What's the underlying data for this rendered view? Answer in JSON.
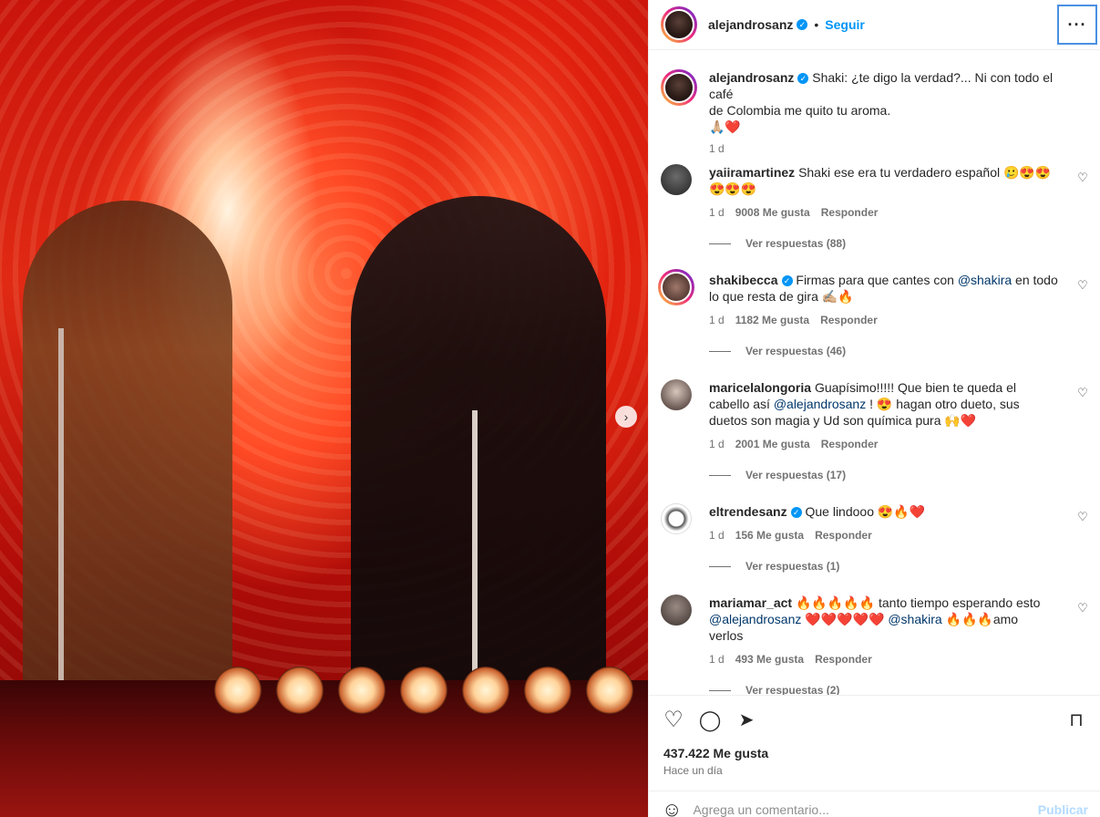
{
  "post": {
    "author": "alejandrosanz",
    "follow_label": "Seguir",
    "more_label": "···",
    "caption": {
      "username": "alejandrosanz",
      "text_line1": "Shaki: ¿te digo la verdad?... Ni con todo el café",
      "text_line2": "de Colombia me quito tu aroma.",
      "emojis": "🙏🏼❤️",
      "time": "1 d"
    }
  },
  "comments": [
    {
      "username": "yaiiramartinez",
      "line1": "Shaki ese era tu verdadero español 🥲😍😍",
      "line2": "😍😍😍",
      "time": "1 d",
      "likes": "9008 Me gusta",
      "reply": "Responder",
      "view_replies": "Ver respuestas (88)"
    },
    {
      "username": "shakibecca",
      "text_pre": "Firmas para que cantes con ",
      "mention": "@shakira",
      "text_post": " en todo",
      "line2": "lo que resta de gira ✍🏼🔥",
      "time": "1 d",
      "likes": "1182 Me gusta",
      "reply": "Responder",
      "view_replies": "Ver respuestas (46)"
    },
    {
      "username": "maricelalongoria",
      "line1": "Guapísimo!!!!! Que bien te queda el",
      "line2_pre": "cabello así ",
      "mention": "@alejandrosanz",
      "line2_post": " ! 😍 hagan otro dueto, sus",
      "line3": "duetos son magia y Ud son química pura 🙌❤️",
      "time": "1 d",
      "likes": "2001 Me gusta",
      "reply": "Responder",
      "view_replies": "Ver respuestas (17)"
    },
    {
      "username": "eltrendesanz",
      "line1": "Que lindooo 😍🔥❤️",
      "time": "1 d",
      "likes": "156 Me gusta",
      "reply": "Responder",
      "view_replies": "Ver respuestas (1)"
    },
    {
      "username": "mariamar_act",
      "line1": "🔥🔥🔥🔥🔥 tanto tiempo esperando esto",
      "mention1": "@alejandrosanz",
      "mid": " ❤️❤️❤️❤️❤️ ",
      "mention2": "@shakira",
      "line2_post": " 🔥🔥🔥amo",
      "line3": "verlos",
      "time": "1 d",
      "likes": "493 Me gusta",
      "reply": "Responder",
      "view_replies": "Ver respuestas (2)"
    }
  ],
  "footer": {
    "likes": "437.422 Me gusta",
    "time": "Hace un día",
    "add_comment_placeholder": "Agrega un comentario...",
    "publish_label": "Publicar"
  }
}
